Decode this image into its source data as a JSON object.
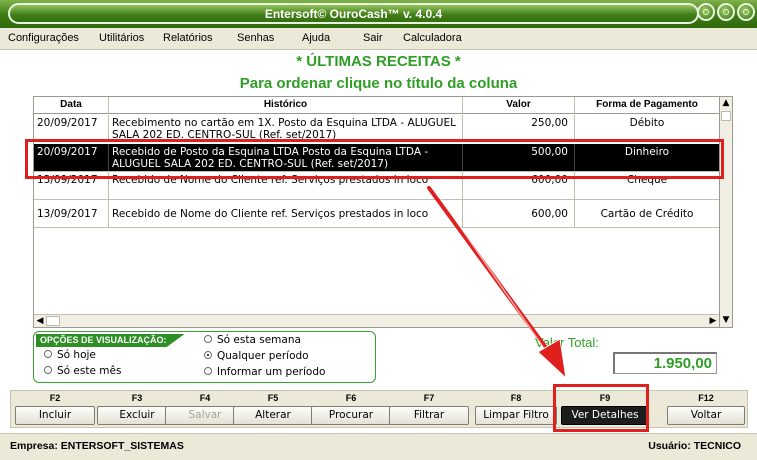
{
  "window": {
    "title": "Entersoft© OuroCash™ v. 4.0.4"
  },
  "menu": [
    {
      "label": "Configurações"
    },
    {
      "label": "Utilitários"
    },
    {
      "label": "Relatórios"
    },
    {
      "label": "Senhas"
    },
    {
      "label": "Ajuda"
    },
    {
      "label": "Sair"
    },
    {
      "label": "Calculadora"
    }
  ],
  "heading": {
    "title": "* ÚLTIMAS RECEITAS *",
    "subtitle": "Para ordenar clique no título da coluna"
  },
  "grid": {
    "columns": [
      "Data",
      "Histórico",
      "Valor",
      "Forma de Pagamento"
    ],
    "rows": [
      {
        "date": "20/09/2017",
        "history": "Recebimento no cartão em 1X. Posto da Esquina LTDA - ALUGUEL SALA 202 ED. CENTRO-SUL (Ref. set/2017)",
        "value": "250,00",
        "payment": "Débito"
      },
      {
        "date": "20/09/2017",
        "history": "Recebido de Posto da Esquina LTDA Posto da Esquina LTDA - ALUGUEL SALA 202 ED. CENTRO-SUL (Ref. set/2017)",
        "value": "500,00",
        "payment": "Dinheiro"
      },
      {
        "date": "13/09/2017",
        "history": "Recebido de Nome do Cliente ref. Serviços prestados in loco",
        "value": "600,00",
        "payment": "Cheque"
      },
      {
        "date": "13/09/2017",
        "history": "Recebido de Nome do Cliente ref. Serviços prestados in loco",
        "value": "600,00",
        "payment": "Cartão de Crédito"
      }
    ],
    "selected_index": 1
  },
  "options": {
    "title": "OPÇÕES DE VISUALIZAÇÃO:",
    "radios": [
      {
        "label": "Só hoje",
        "checked": false
      },
      {
        "label": "Só este mês",
        "checked": false
      },
      {
        "label": "Só esta semana",
        "checked": false
      },
      {
        "label": "Qualquer período",
        "checked": true
      },
      {
        "label": "Informar um período",
        "checked": false
      }
    ]
  },
  "total": {
    "label": "Valor Total:",
    "value": "1.950,00"
  },
  "fkeys": [
    {
      "key": "F2",
      "label": "Incluir",
      "state": "normal"
    },
    {
      "key": "F3",
      "label": "Excluir",
      "state": "normal"
    },
    {
      "key": "F4",
      "label": "Salvar",
      "state": "disabled"
    },
    {
      "key": "F5",
      "label": "Alterar",
      "state": "normal"
    },
    {
      "key": "F6",
      "label": "Procurar",
      "state": "normal"
    },
    {
      "key": "F7",
      "label": "Filtrar",
      "state": "normal"
    },
    {
      "key": "F8",
      "label": "Limpar Filtro",
      "state": "normal"
    },
    {
      "key": "F9",
      "label": "Ver Detalhes",
      "state": "focused"
    },
    {
      "key": "F12",
      "label": "Voltar",
      "state": "normal"
    }
  ],
  "status": {
    "company": "Empresa: ENTERSOFT_SISTEMAS",
    "user": "Usuário: TECNICO"
  },
  "colors": {
    "title_green": "#3c7a14",
    "heading_green": "#2f9e25",
    "annotation_red": "#e0201f"
  }
}
